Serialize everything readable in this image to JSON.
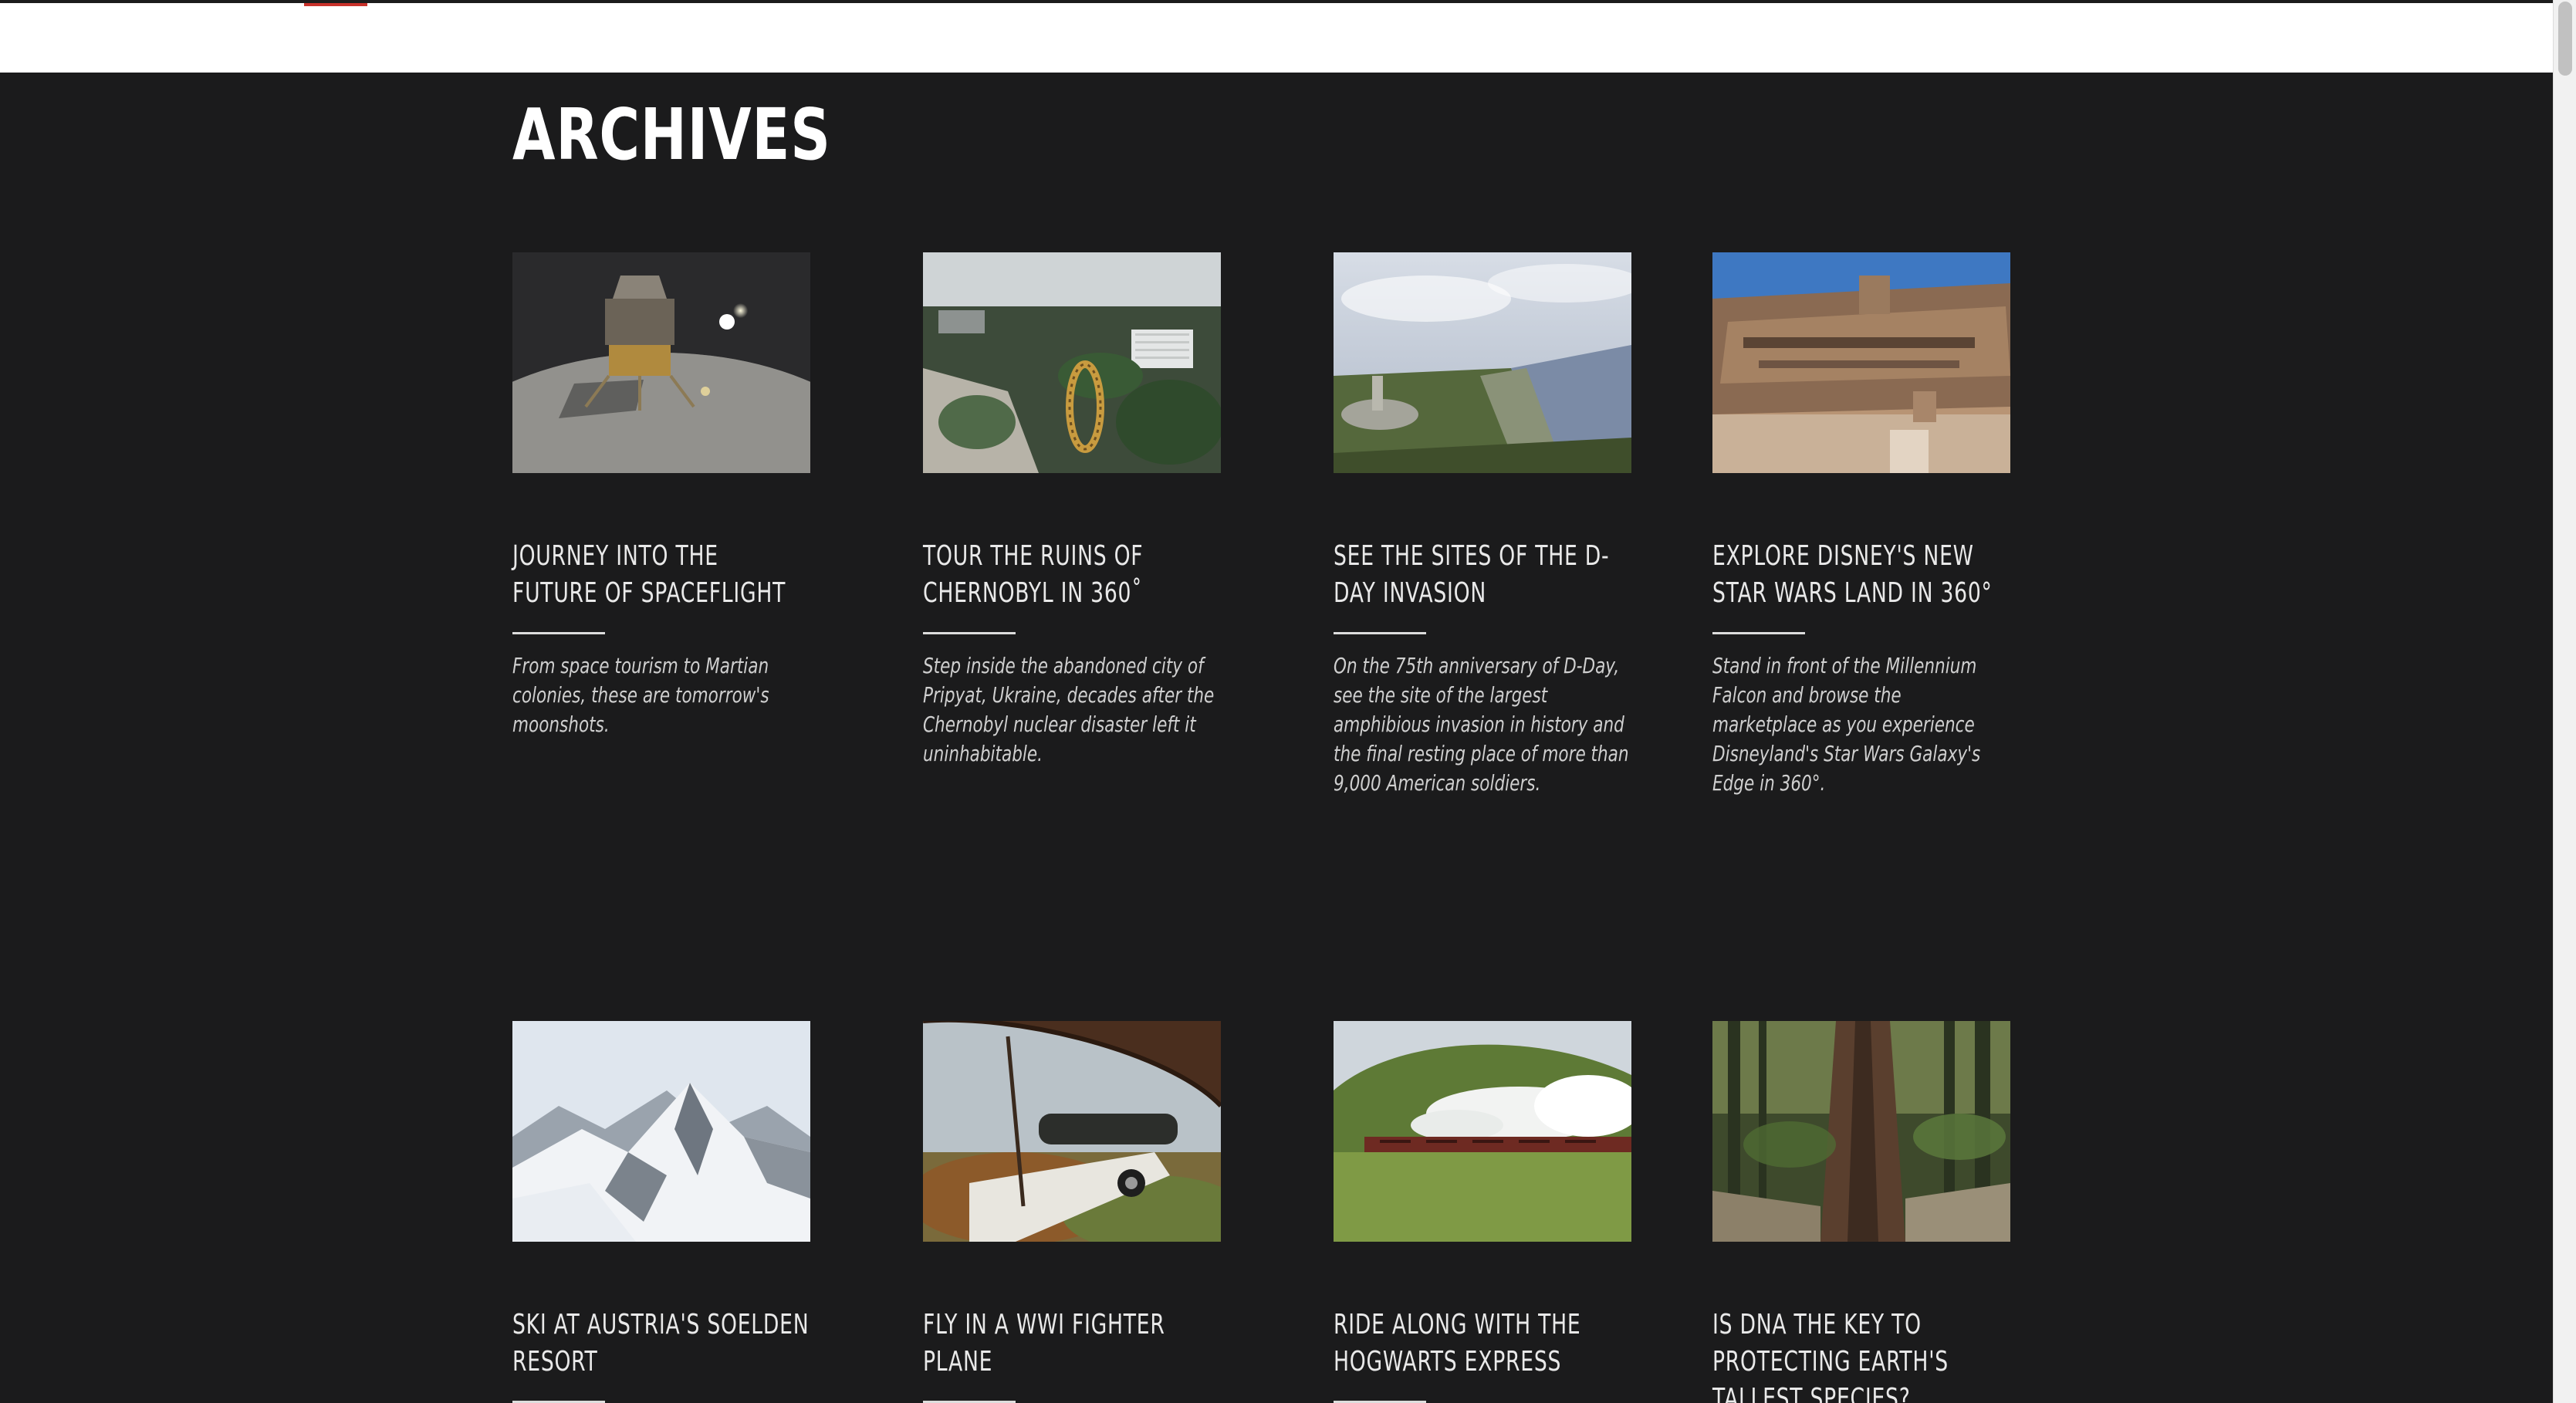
{
  "section": {
    "title": "ARCHIVES"
  },
  "cards": [
    {
      "headline": "JOURNEY INTO THE FUTURE OF SPACEFLIGHT",
      "dek": "From space tourism to Martian colonies, these are tomorrow's moonshots."
    },
    {
      "headline": "TOUR THE RUINS OF CHERNOBYL IN 360˚",
      "dek": "Step inside the abandoned city of Pripyat, Ukraine, decades after the Chernobyl nuclear disaster left it uninhabitable."
    },
    {
      "headline": "SEE THE SITES OF THE D-DAY INVASION",
      "dek": "On the 75th anniversary of D-Day, see the site of the largest amphibious invasion in history and the final resting place of more than 9,000 American soldiers."
    },
    {
      "headline": "EXPLORE DISNEY'S NEW STAR WARS LAND IN 360°",
      "dek": "Stand in front of the Millennium Falcon and browse the marketplace as you experience Disneyland's Star Wars Galaxy's Edge in 360°."
    },
    {
      "headline": "SKI AT AUSTRIA'S SOELDEN RESORT",
      "dek": ""
    },
    {
      "headline": "FLY IN A WWI FIGHTER PLANE",
      "dek": ""
    },
    {
      "headline": "RIDE ALONG WITH THE HOGWARTS EXPRESS",
      "dek": ""
    },
    {
      "headline": "IS DNA THE KEY TO PROTECTING EARTH'S TALLEST SPECIES?",
      "dek": ""
    }
  ],
  "colors": {
    "background": "#1b1b1c",
    "accent": "#c8312a",
    "text": "#e9e9e9"
  }
}
